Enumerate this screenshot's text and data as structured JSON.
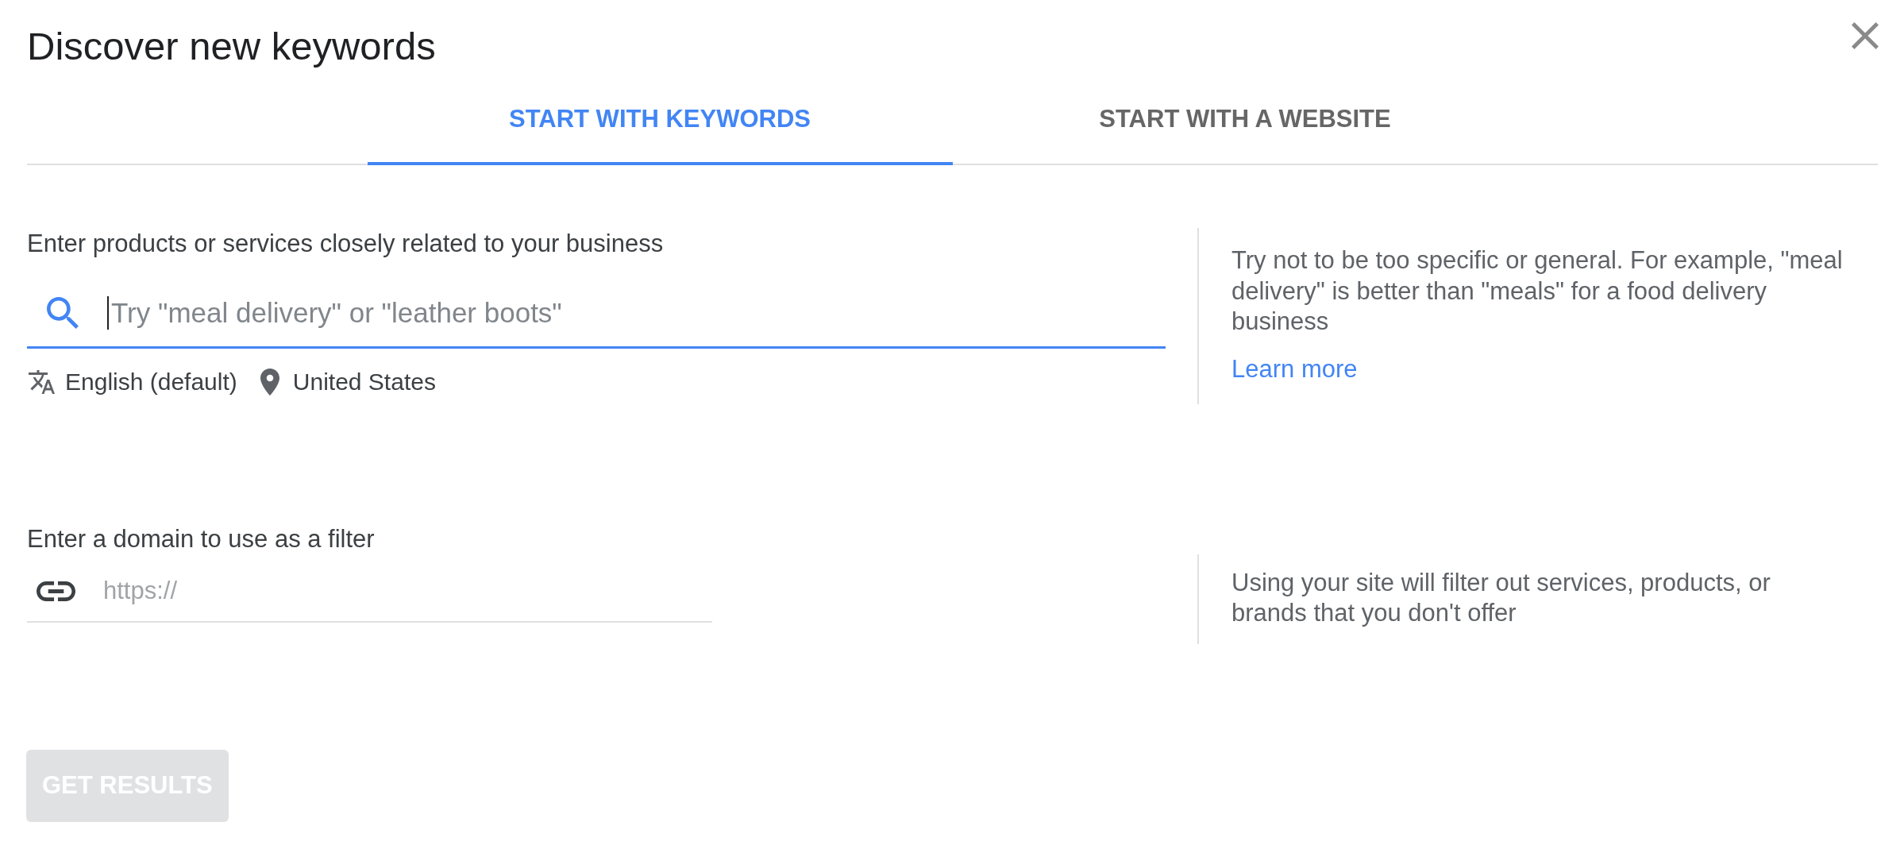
{
  "title": "Discover new keywords",
  "tabs": [
    {
      "label": "START WITH KEYWORDS",
      "selected": true
    },
    {
      "label": "START WITH A WEBSITE",
      "selected": false
    }
  ],
  "keywords_section": {
    "label": "Enter products or services closely related to your business",
    "search": {
      "placeholder": "Try \"meal delivery\" or \"leather boots\"",
      "focused": true
    },
    "language": "English (default)",
    "location": "United States",
    "hint": "Try not to be too specific or general. For example, \"meal delivery\" is better than \"meals\" for a food delivery business",
    "link": "Learn more"
  },
  "domain_section": {
    "label": "Enter a domain to use as a filter",
    "field": {
      "placeholder": "https://",
      "focused": false
    },
    "hint": "Using your site will filter out services, products, or brands that you don't offer"
  },
  "button": {
    "label": "GET RESULTS",
    "disabled": true
  }
}
